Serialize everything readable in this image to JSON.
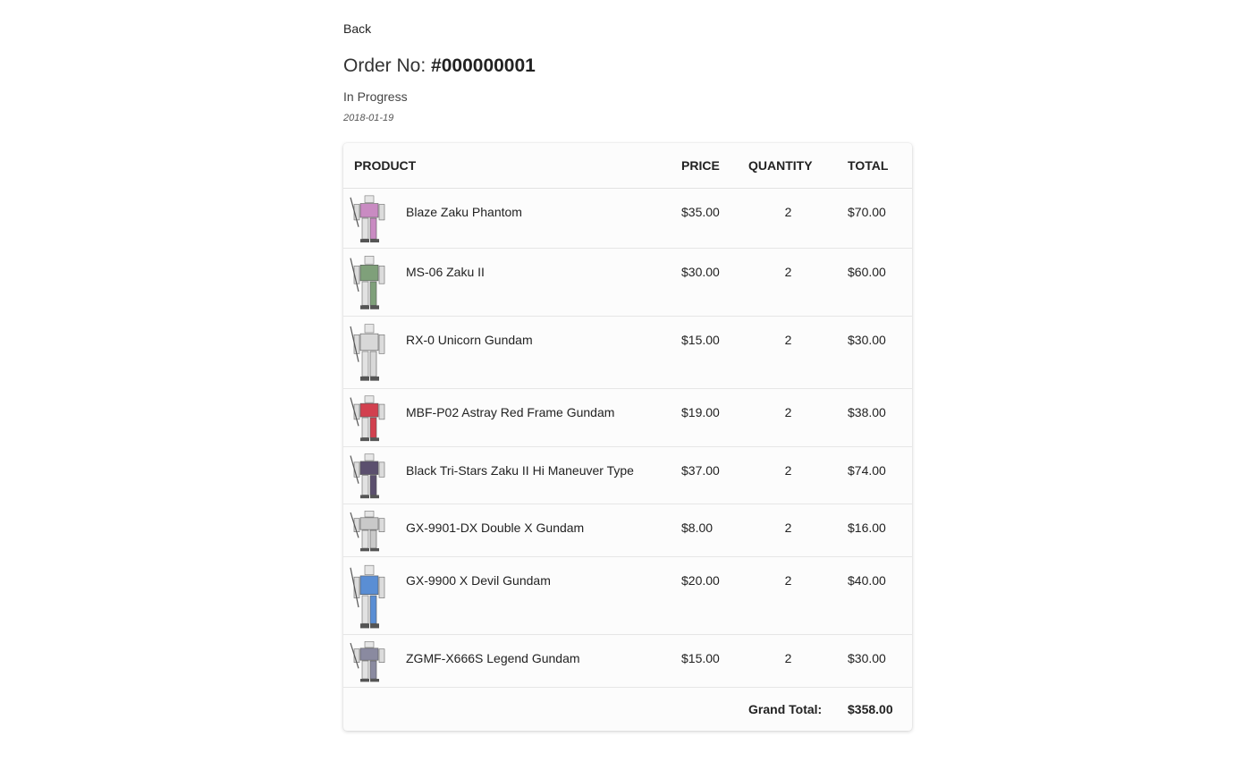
{
  "nav": {
    "back_label": "Back"
  },
  "order": {
    "title_prefix": "Order No:",
    "number": "#000000001",
    "status": "In Progress",
    "date": "2018-01-19"
  },
  "table": {
    "headers": {
      "product": "PRODUCT",
      "price": "PRICE",
      "quantity": "QUANTITY",
      "total": "TOTAL"
    },
    "rows": [
      {
        "name": "Blaze Zaku Phantom",
        "price": "$35.00",
        "quantity": "2",
        "total": "$70.00",
        "accent": "#c98bc2"
      },
      {
        "name": "MS-06 Zaku II",
        "price": "$30.00",
        "quantity": "2",
        "total": "$60.00",
        "accent": "#7fa07a"
      },
      {
        "name": "RX-0 Unicorn Gundam",
        "price": "$15.00",
        "quantity": "2",
        "total": "$30.00",
        "accent": "#d8d8d8"
      },
      {
        "name": "MBF-P02 Astray Red Frame Gundam",
        "price": "$19.00",
        "quantity": "2",
        "total": "$38.00",
        "accent": "#d2404f"
      },
      {
        "name": "Black Tri-Stars Zaku II Hi Maneuver Type",
        "price": "$37.00",
        "quantity": "2",
        "total": "$74.00",
        "accent": "#5b4f6e"
      },
      {
        "name": "GX-9901-DX Double X Gundam",
        "price": "$8.00",
        "quantity": "2",
        "total": "$16.00",
        "accent": "#c9c9c9"
      },
      {
        "name": "GX-9900 X Devil Gundam",
        "price": "$20.00",
        "quantity": "2",
        "total": "$40.00",
        "accent": "#5a8ed4"
      },
      {
        "name": "ZGMF-X666S Legend Gundam",
        "price": "$15.00",
        "quantity": "2",
        "total": "$30.00",
        "accent": "#8a8aa0"
      }
    ],
    "grand_total_label": "Grand Total:",
    "grand_total": "$358.00"
  }
}
